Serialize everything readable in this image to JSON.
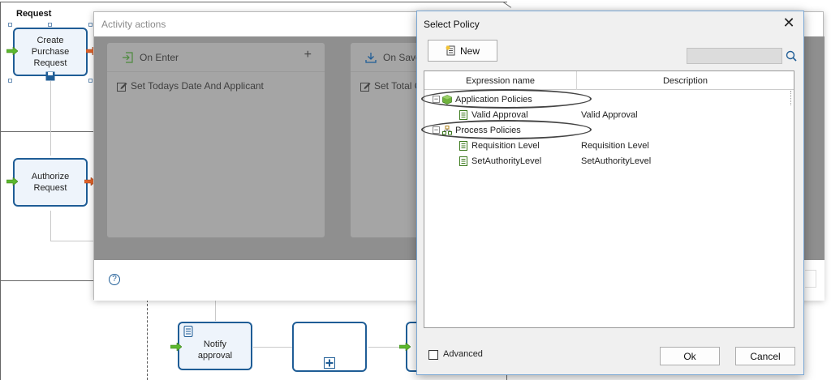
{
  "diagram": {
    "lane_label": "Request",
    "tasks": {
      "create_purchase_request": "Create\nPurchase\nRequest",
      "authorize_request": "Authorize\nRequest",
      "notify_approval": "Notify\napproval"
    }
  },
  "activity_actions": {
    "title": "Activity actions",
    "on_enter": {
      "label": "On Enter",
      "items": [
        "Set Todays Date And Applicant"
      ]
    },
    "on_save": {
      "label": "On Save",
      "items": [
        "Set Total C"
      ]
    },
    "help_glyph": "?"
  },
  "select_policy": {
    "title": "Select Policy",
    "close_glyph": "✕",
    "new_button": "New",
    "columns": [
      "Expression name",
      "Description"
    ],
    "groups": [
      {
        "name": "Application Policies",
        "icon": "cube-icon",
        "items": [
          {
            "name": "Valid Approval",
            "description": "Valid Approval"
          }
        ]
      },
      {
        "name": "Process Policies",
        "icon": "process-icon",
        "items": [
          {
            "name": "Requisition Level",
            "description": "Requisition Level"
          },
          {
            "name": "SetAuthorityLevel",
            "description": "SetAuthorityLevel"
          }
        ]
      }
    ],
    "advanced_label": "Advanced",
    "advanced_checked": false,
    "ok_button": "Ok",
    "cancel_button": "Cancel"
  },
  "colors": {
    "task_border": "#1f5d96",
    "dialog_border": "#7aa7d4",
    "overlay": "#8f8f8f"
  }
}
